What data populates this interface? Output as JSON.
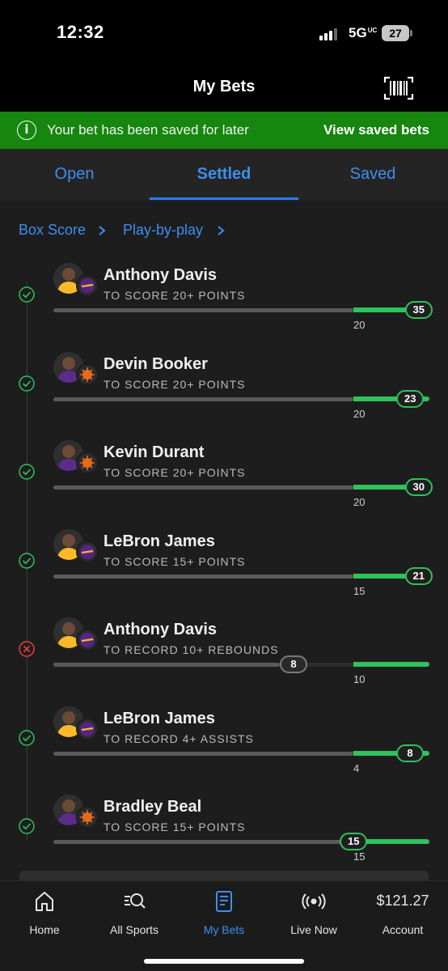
{
  "status_bar": {
    "time": "12:32",
    "network": "5G",
    "network_sub": "UC",
    "battery": "27"
  },
  "header": {
    "title": "My Bets"
  },
  "banner": {
    "message": "Your bet has been saved for later",
    "link": "View saved bets"
  },
  "tabs": [
    {
      "label": "Open"
    },
    {
      "label": "Settled"
    },
    {
      "label": "Saved"
    }
  ],
  "links": {
    "box_score": "Box Score",
    "play_by_play": "Play-by-play"
  },
  "bets": [
    {
      "player": "Anthony Davis",
      "market": "TO SCORE 20+ POINTS",
      "line": "20",
      "result": "35",
      "won": true,
      "team": "Lakers"
    },
    {
      "player": "Devin Booker",
      "market": "TO SCORE 20+ POINTS",
      "line": "20",
      "result": "23",
      "won": true,
      "team": "Suns"
    },
    {
      "player": "Kevin Durant",
      "market": "TO SCORE 20+ POINTS",
      "line": "20",
      "result": "30",
      "won": true,
      "team": "Suns"
    },
    {
      "player": "LeBron James",
      "market": "TO SCORE 15+ POINTS",
      "line": "15",
      "result": "21",
      "won": true,
      "team": "Lakers"
    },
    {
      "player": "Anthony Davis",
      "market": "TO RECORD 10+ REBOUNDS",
      "line": "10",
      "result": "8",
      "won": false,
      "team": "Lakers"
    },
    {
      "player": "LeBron James",
      "market": "TO RECORD 4+ ASSISTS",
      "line": "4",
      "result": "8",
      "won": true,
      "team": "Lakers"
    },
    {
      "player": "Bradley Beal",
      "market": "TO SCORE 15+ POINTS",
      "line": "15",
      "result": "15",
      "won": true,
      "team": "Suns"
    }
  ],
  "nav": [
    {
      "label": "Home",
      "icon": "home-icon"
    },
    {
      "label": "All Sports",
      "icon": "search-sports-icon"
    },
    {
      "label": "My Bets",
      "icon": "bet-slip-icon"
    },
    {
      "label": "Live Now",
      "icon": "live-broadcast-icon"
    },
    {
      "label": "Account",
      "icon": "account-balance",
      "balance": "$121.27"
    }
  ],
  "colors": {
    "accent_blue": "#3d8ef0",
    "banner_green": "#16860e",
    "win_green": "#2fc25a",
    "loss_red": "#e5413c",
    "background": "#1d1d1d"
  }
}
